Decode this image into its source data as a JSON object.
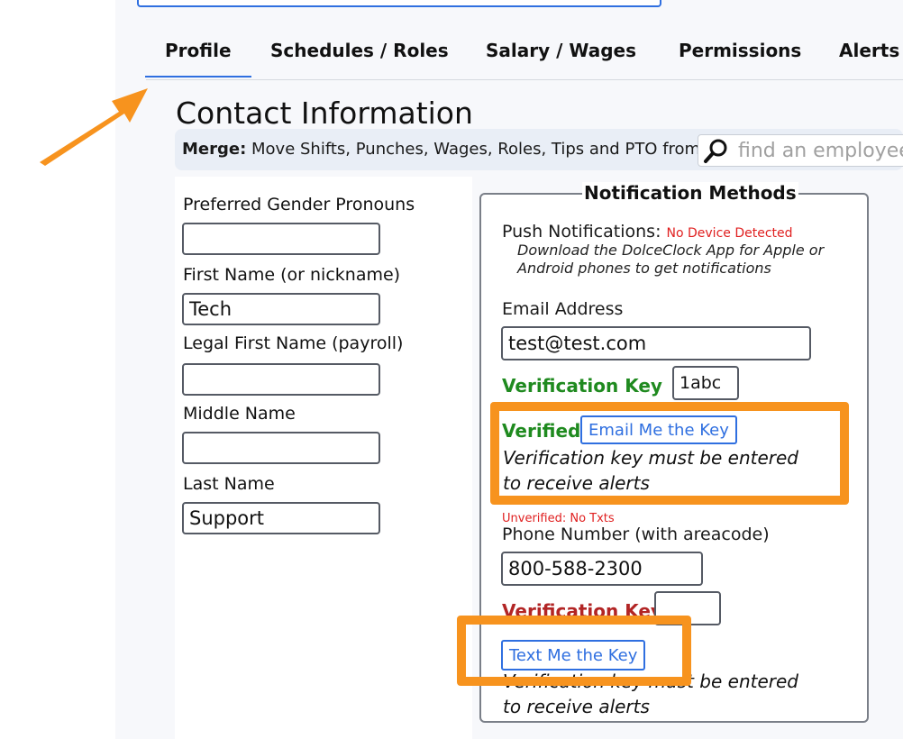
{
  "tabs": [
    {
      "label": "Profile",
      "active": true
    },
    {
      "label": "Schedules / Roles"
    },
    {
      "label": "Salary / Wages"
    },
    {
      "label": "Permissions"
    },
    {
      "label": "Alerts"
    }
  ],
  "section_title": "Contact Information",
  "merge": {
    "label_bold": "Merge:",
    "label_rest": " Move Shifts, Punches, Wages, Roles, Tips and PTO from",
    "search_placeholder": "find an employee"
  },
  "profile_fields": {
    "pronouns": {
      "label": "Preferred Gender Pronouns",
      "value": ""
    },
    "first_name": {
      "label": "First Name (or nickname)",
      "value": "Tech"
    },
    "legal_first": {
      "label": "Legal First Name (payroll)",
      "value": ""
    },
    "middle": {
      "label": "Middle Name",
      "value": ""
    },
    "last": {
      "label": "Last Name",
      "value": "Support"
    }
  },
  "notification": {
    "title": "Notification Methods",
    "push_label": "Push Notifications:",
    "push_status": "No Device Detected",
    "push_note_1": "Download the DolceClock App for Apple or",
    "push_note_2": "Android phones to get notifications",
    "email_label": "Email Address",
    "email_value": "test@test.com",
    "email_vkey_label": "Verification Key",
    "email_vkey_value": "1abc",
    "email_status": "Verified",
    "email_button": "Email Me the Key",
    "email_note_1": "Verification key must be entered",
    "email_note_2": "to receive alerts",
    "phone_status": "Unverified: No Txts",
    "phone_label": "Phone Number (with areacode)",
    "phone_value": "800-588-2300",
    "phone_vkey_label": "Verification Key",
    "phone_vkey_value": "",
    "phone_button": "Text Me the Key",
    "phone_note_1": "Verification key must be entered",
    "phone_note_2": "to receive alerts"
  },
  "colors": {
    "accent": "#2f6fe0",
    "highlight": "#f7931e",
    "verified_green": "#1f8a1f",
    "unverified_red": "#b22525"
  }
}
